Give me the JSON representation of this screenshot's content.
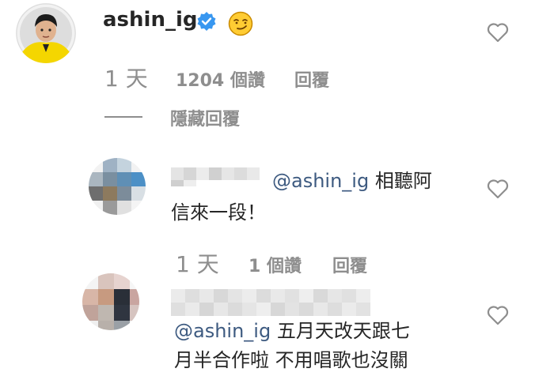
{
  "main_comment": {
    "username": "ashin_ig",
    "time": "1 天",
    "likes": "1204 個讚",
    "reply": "回覆",
    "hide_replies": "隱藏回覆"
  },
  "replies": [
    {
      "mention": "@ashin_ig",
      "text_line1": "相聽阿",
      "text_line2": "信來一段！",
      "time": "1 天",
      "likes": "1 個讚",
      "reply": "回覆"
    },
    {
      "mention": "@ashin_ig",
      "text_line1": "五月天改天跟七",
      "text_line2": "月半合作啦 不用唱歌也沒關"
    }
  ],
  "colors": {
    "text": "#262626",
    "meta": "#8e8e8e",
    "verified": "#3897f0",
    "mention": "#3d5a80"
  },
  "icons": [
    "verified-badge-icon",
    "smirk-emoji-icon",
    "heart-icon"
  ]
}
